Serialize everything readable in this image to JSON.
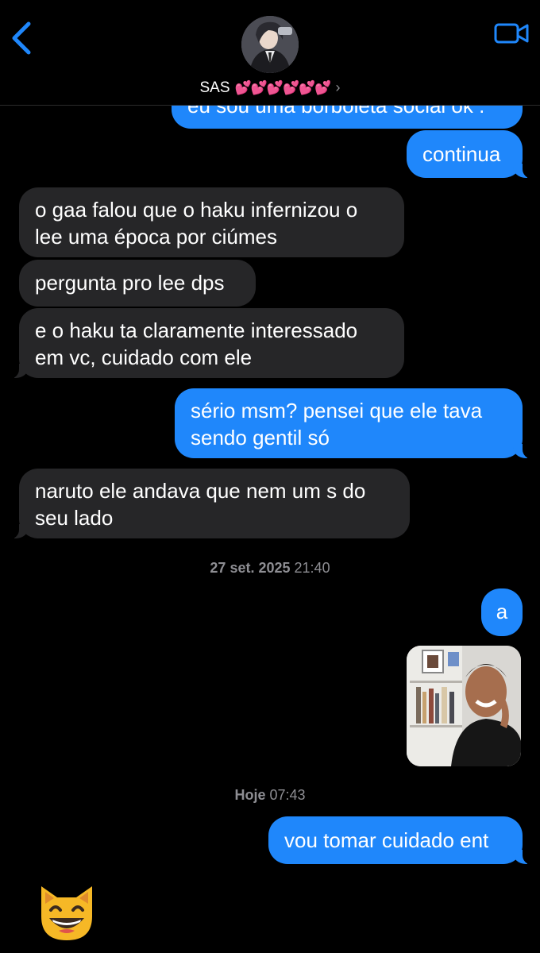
{
  "header": {
    "contact_name": "SAS",
    "contact_hearts": "💕💕💕💕💕💕",
    "contact_chevron": "›"
  },
  "messages": [
    {
      "side": "out",
      "text": "eu sou uma borboleta social ok ."
    },
    {
      "side": "out",
      "text": "continua"
    },
    {
      "side": "in",
      "text": "o gaa falou que o haku infernizou o lee uma época por ciúmes"
    },
    {
      "side": "in",
      "text": "pergunta pro lee dps"
    },
    {
      "side": "in",
      "text": "e o haku ta claramente interessado em vc, cuidado com ele"
    },
    {
      "side": "out",
      "text": "sério msm? pensei que ele tava sendo gentil só"
    },
    {
      "side": "in",
      "text": "naruto ele andava que nem um s do seu lado"
    },
    {
      "side": "out",
      "text": "a"
    },
    {
      "side": "out",
      "text": "vou tomar cuidado ent"
    }
  ],
  "timestamps": [
    {
      "date": "27 set. 2025",
      "time": "21:40"
    },
    {
      "date": "Hoje",
      "time": "07:43"
    }
  ],
  "attachments": {
    "photo_desc": "photo-attachment"
  },
  "reactions": {
    "emoji": "smiling-cat-emoji"
  },
  "colors": {
    "outgoing_bubble": "#1f87fb",
    "incoming_bubble": "#262628",
    "accent": "#1f87fb",
    "timestamp": "#8e8e93"
  }
}
